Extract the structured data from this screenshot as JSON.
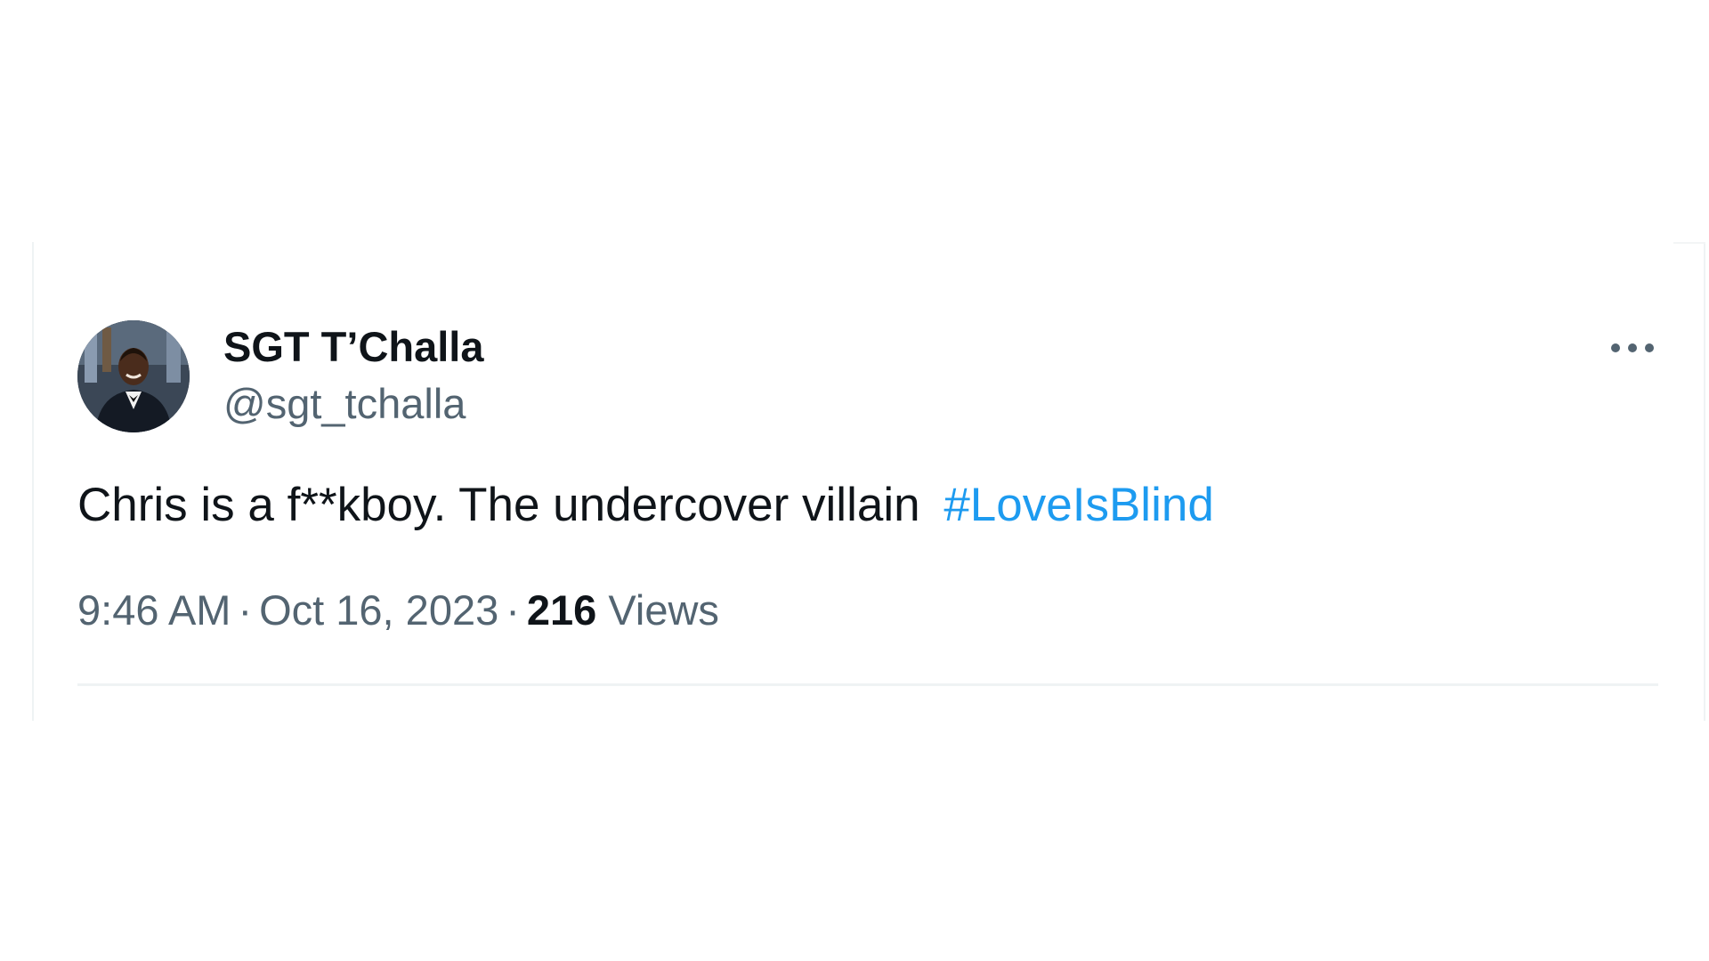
{
  "tweet": {
    "author": {
      "display_name": "SGT T’Challa",
      "handle": "@sgt_tchalla",
      "avatar_icon": "profile-photo"
    },
    "text": "Chris is a f**kboy. The undercover villain",
    "hashtag": "#LoveIsBlind",
    "time": "9:46 AM",
    "date": "Oct 16, 2023",
    "separator": "·",
    "views_count": "216",
    "views_label": "Views",
    "more_icon": "more-options-icon"
  },
  "colors": {
    "text_primary": "#0f1419",
    "text_secondary": "#536471",
    "link": "#1d9bf0",
    "border": "#eff3f4"
  }
}
